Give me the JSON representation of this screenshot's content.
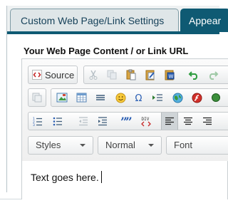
{
  "tabs": {
    "active_label": "Custom Web Page/Link Settings",
    "inactive_label": "Appear"
  },
  "section": {
    "label": "Your Web Page Content / or Link URL"
  },
  "editor": {
    "source_label": "Source",
    "styles_label": "Styles",
    "format_label": "Normal",
    "font_label": "Font",
    "content_text": "Text goes here."
  },
  "colors": {
    "accent": "#0f5a73",
    "tab_active_bg": "#dfe6e8",
    "tab_text": "#17425a"
  }
}
